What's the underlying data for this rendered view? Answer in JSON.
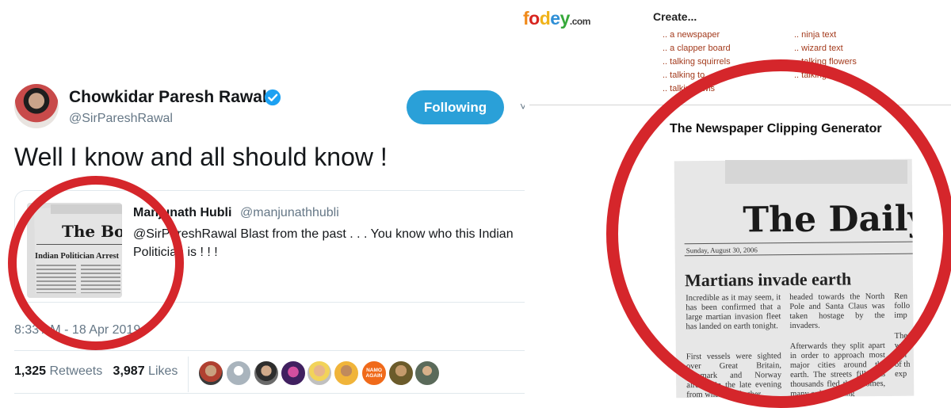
{
  "tweet": {
    "display_name": "Chowkidar Paresh Rawal",
    "handle": "@SirPareshRawal",
    "follow_label": "Following",
    "text": "Well I know and all should know !",
    "quoted": {
      "name": "Manjunath Hubli",
      "handle": "@manjunathhubli",
      "text": "@SirPareshRawal Blast from the past . . . You know who this Indian Politician is ! ! !",
      "thumb_masthead": "The Bost",
      "thumb_headline": "Indian Politician Arrest"
    },
    "timestamp": "8:33 AM - 18 Apr 2019",
    "retweets_count": "1,325",
    "retweets_label": "Retweets",
    "likes_count": "3,987",
    "likes_label": "Likes",
    "liker_avatar_badge": "NAMO AGAIN"
  },
  "fodey": {
    "logo_text": "fodey",
    "logo_suffix": ".com",
    "create_label": "Create...",
    "menu_col1": [
      ".. a newspaper",
      ".. a clapper board",
      ".. talking squirrels",
      ".. talking to",
      ".. talking owls"
    ],
    "menu_col2": [
      ".. ninja text",
      ".. wizard text",
      ".. talking flowers",
      ".. talking"
    ],
    "generator_title": "The Newspaper Clipping Generator",
    "newspaper": {
      "masthead": "The Daily W",
      "date": "Sunday, August 30, 2006",
      "headline": "Martians invade earth",
      "col1": "Incredible as it may seem, it has been confirmed that a large martian invasion fleet has landed on earth tonight.",
      "col1b": "First vessels were sighted over Great Britain, Denmark and Norway already in the late evening from where, as further",
      "col2": "headed towards the North Pole and Santa Claus was taken hostage by the invaders.",
      "col2b": "Afterwards they split apart in order to approach most major cities around the earth. The streets filled as thousands fled their homes, many only wearing",
      "col3": "Ren follo imp",
      "col3b": "The wi beh of th exp"
    }
  },
  "colors": {
    "twitter_blue": "#2aa0d8",
    "annotation_red": "#d5262b",
    "fodey_link": "#a33a1c"
  }
}
